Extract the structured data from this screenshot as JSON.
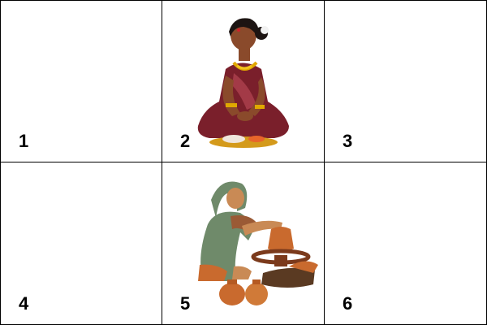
{
  "cells": [
    {
      "number": "1",
      "image": null
    },
    {
      "number": "2",
      "image": "seated-woman-with-plate-illustration"
    },
    {
      "number": "3",
      "image": null
    },
    {
      "number": "4",
      "image": null
    },
    {
      "number": "5",
      "image": "woman-potter-at-wheel-illustration"
    },
    {
      "number": "6",
      "image": null
    }
  ],
  "colors": {
    "border": "#000000",
    "saree": "#7a1f2b",
    "gold": "#e0a800",
    "skin": "#8a4a2b",
    "clay": "#c96a2e",
    "green_saree": "#6f8a6a"
  }
}
